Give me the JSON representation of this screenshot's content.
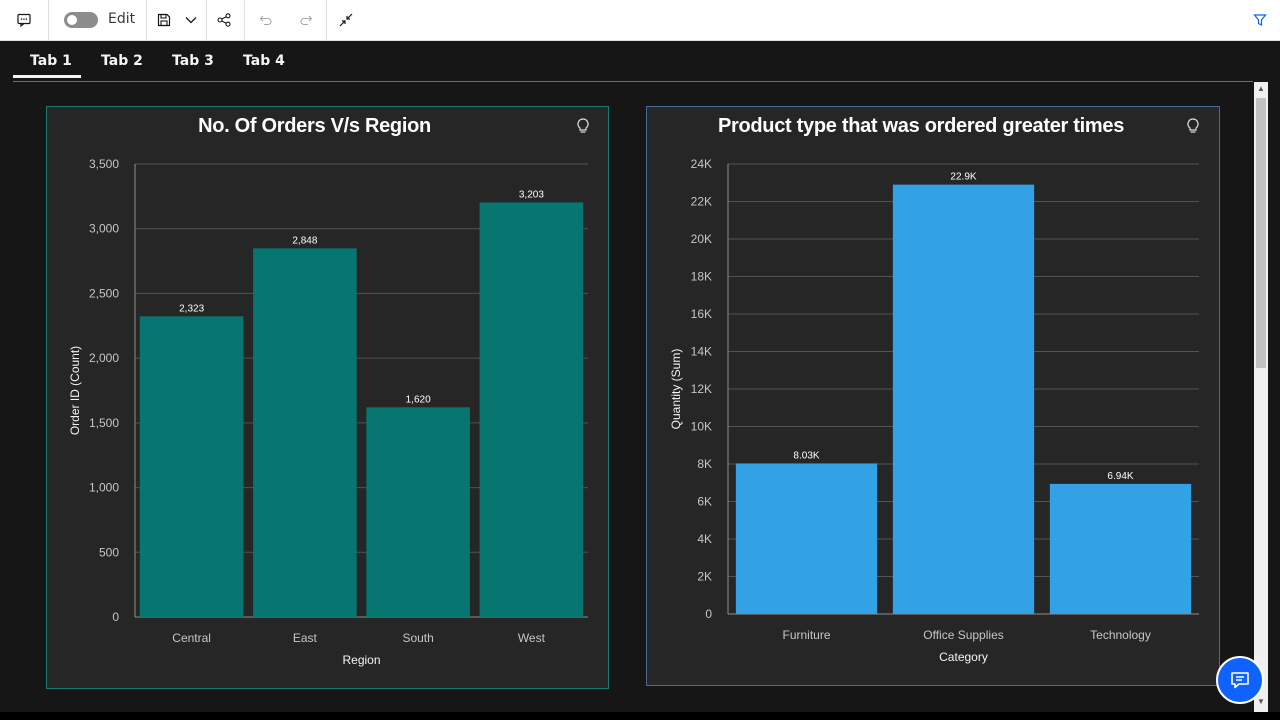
{
  "toolbar": {
    "edit_label": "Edit",
    "icons": [
      "comment-icon",
      "toggle-switch",
      "save-icon",
      "chevron-down-icon",
      "share-icon",
      "undo-icon",
      "redo-icon",
      "collapse-icon",
      "filter-icon"
    ]
  },
  "tabs": [
    {
      "label": "Tab 1",
      "selected": true
    },
    {
      "label": "Tab 2",
      "selected": false
    },
    {
      "label": "Tab 3",
      "selected": false
    },
    {
      "label": "Tab 4",
      "selected": false
    }
  ],
  "chart1": {
    "title": "No. Of Orders V/s Region"
  },
  "chart2": {
    "title": "Product type that was ordered greater times"
  },
  "colors": {
    "teal_bar": "#077670",
    "blue_bar": "#33a1e6",
    "panel_bg": "#262626",
    "accent": "#0f62fe"
  },
  "chart_data": [
    {
      "type": "bar",
      "title": "No. Of Orders V/s Region",
      "categories": [
        "Central",
        "East",
        "South",
        "West"
      ],
      "values": [
        2323,
        2848,
        1620,
        3203
      ],
      "data_labels": [
        "2,323",
        "2,848",
        "1,620",
        "3,203"
      ],
      "xlabel": "Region",
      "ylabel": "Order ID (Count)",
      "ylim": [
        0,
        3500
      ],
      "yticks": [
        0,
        500,
        1000,
        1500,
        2000,
        2500,
        3000,
        3500
      ],
      "ytick_labels": [
        "0",
        "500",
        "1,000",
        "1,500",
        "2,000",
        "2,500",
        "3,000",
        "3,500"
      ],
      "grid": true
    },
    {
      "type": "bar",
      "title": "Product type that was ordered greater times",
      "categories": [
        "Furniture",
        "Office Supplies",
        "Technology"
      ],
      "values": [
        8030,
        22900,
        6940
      ],
      "data_labels": [
        "8.03K",
        "22.9K",
        "6.94K"
      ],
      "xlabel": "Category",
      "ylabel": "Quantity (Sum)",
      "ylim": [
        0,
        24000
      ],
      "yticks": [
        0,
        2000,
        4000,
        6000,
        8000,
        10000,
        12000,
        14000,
        16000,
        18000,
        20000,
        22000,
        24000
      ],
      "ytick_labels": [
        "0",
        "2K",
        "4K",
        "6K",
        "8K",
        "10K",
        "12K",
        "14K",
        "16K",
        "18K",
        "20K",
        "22K",
        "24K"
      ],
      "grid": true
    }
  ]
}
